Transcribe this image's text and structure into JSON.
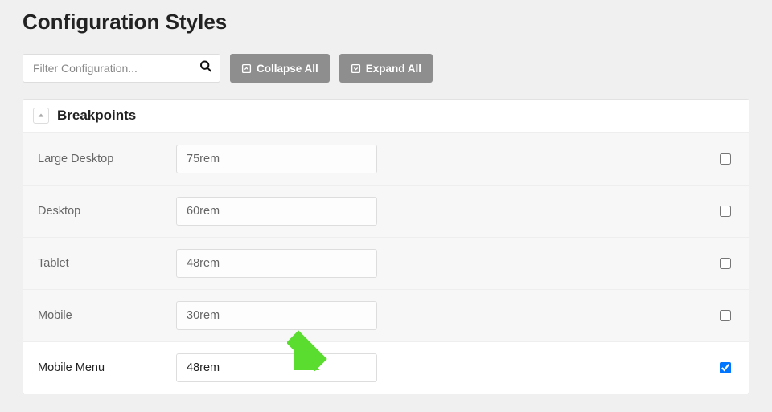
{
  "title": "Configuration Styles",
  "search": {
    "placeholder": "Filter Configuration..."
  },
  "buttons": {
    "collapse": "Collapse All",
    "expand": "Expand All"
  },
  "panel": {
    "title": "Breakpoints",
    "rows": [
      {
        "label": "Large Desktop",
        "value": "75rem",
        "checked": false,
        "active": false
      },
      {
        "label": "Desktop",
        "value": "60rem",
        "checked": false,
        "active": false
      },
      {
        "label": "Tablet",
        "value": "48rem",
        "checked": false,
        "active": false
      },
      {
        "label": "Mobile",
        "value": "30rem",
        "checked": false,
        "active": false
      },
      {
        "label": "Mobile Menu",
        "value": "48rem",
        "checked": true,
        "active": true
      }
    ]
  }
}
